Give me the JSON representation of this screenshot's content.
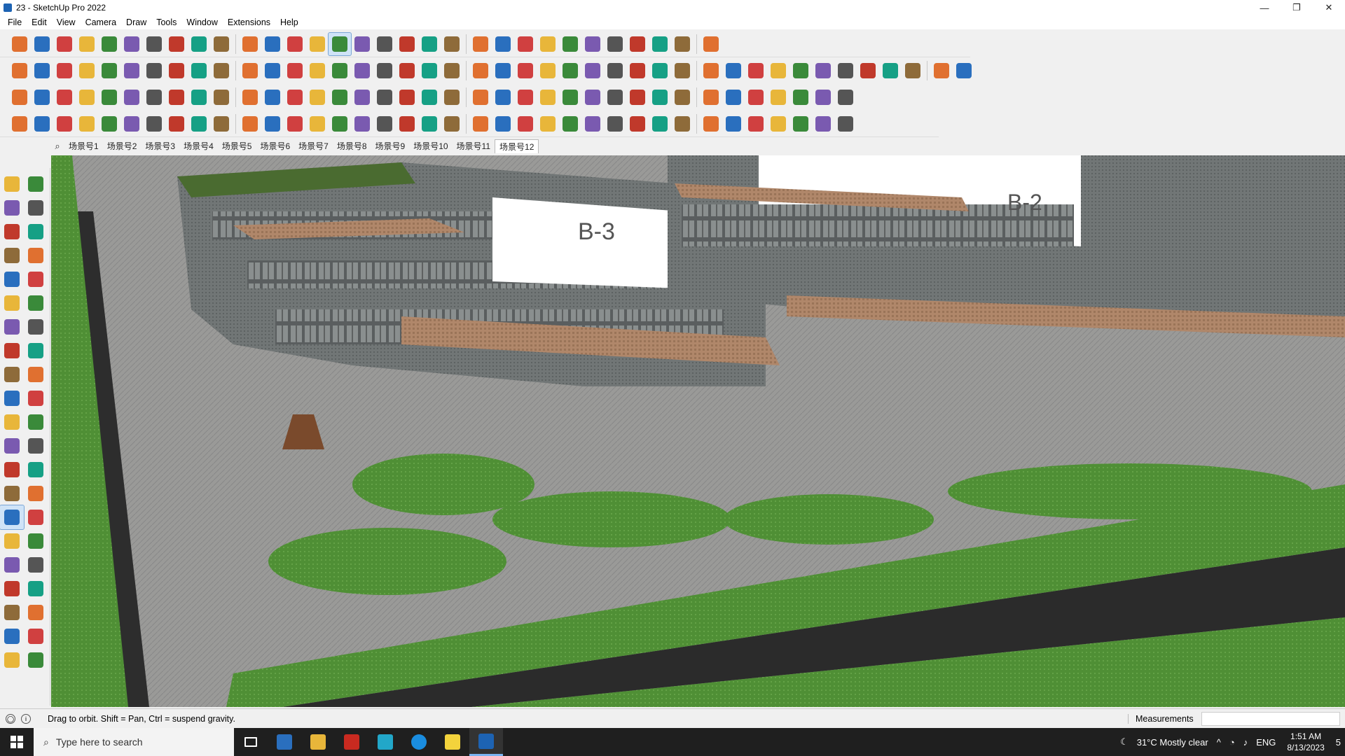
{
  "window": {
    "title": "23 - SketchUp Pro 2022",
    "controls": [
      "—",
      "❐",
      "✕"
    ]
  },
  "menu": [
    "File",
    "Edit",
    "View",
    "Camera",
    "Draw",
    "Tools",
    "Window",
    "Extensions",
    "Help"
  ],
  "toolbars": {
    "row1": [
      "zoom-extents",
      "select",
      "eraser",
      "pencil-line",
      "arc",
      "rectangle",
      "push-pull",
      "follow-me",
      "move",
      "rotate",
      "scale",
      "tape-measure",
      "text",
      "paint-bucket",
      "orbit",
      "pan",
      "zoom",
      "zoom-window",
      "sandbox",
      "layers-1",
      "layers-2",
      "layers-3",
      "section",
      "walk",
      "camera-tool",
      "look",
      "position",
      "flip",
      "undo",
      "redo",
      "model-info"
    ],
    "row2": [
      "solid-1",
      "solid-2",
      "solid-3",
      "push-red",
      "move-up",
      "move-down",
      "shear",
      "axis",
      "twist",
      "warp",
      "curve",
      "section-a",
      "section-b",
      "section-c",
      "ladder-1",
      "ladder-2",
      "house-1",
      "house-2",
      "house-3",
      "house-4",
      "house-5",
      "tag",
      "stone",
      "shape-1",
      "shape-2",
      "shape-3",
      "shape-4",
      "shape-5",
      "shape-6",
      "shape-7",
      "shape-8",
      "shape-9",
      "shape-10",
      "shape-11",
      "tool-a",
      "tool-b",
      "tool-c",
      "tool-d",
      "tool-e",
      "tool-f",
      "tool-g",
      "tool-h"
    ],
    "row3": [
      "plane-1",
      "plane-2",
      "plane-3",
      "plane-4",
      "plane-5",
      "curve-a",
      "box-a",
      "frame-a",
      "door-a",
      "glass-a",
      "curve-b",
      "path-a",
      "pipe-a",
      "cross-a",
      "x-a",
      "cone-a",
      "tent-a",
      "warn-a",
      "loop-a",
      "loop-b",
      "loop-c",
      "flower-a",
      "cup-a",
      "hook-a",
      "tree-a",
      "grid-a",
      "grid-b",
      "grid-c",
      "grid-d",
      "grid-e",
      "grid-f",
      "tile-a",
      "tile-b",
      "tile-c",
      "x-b",
      "arc-a",
      "dots-a"
    ],
    "row4": [
      "poly-1",
      "poly-2",
      "poly-3",
      "poly-4",
      "poly-5",
      "poly-6",
      "poly-7",
      "poly-8",
      "poly-9",
      "poly-10",
      "poly-11",
      "poly-12",
      "poly-13",
      "poly-14",
      "poly-15",
      "poly-16",
      "poly-17",
      "poly-18",
      "poly-19",
      "poly-20",
      "poly-21",
      "poly-22",
      "poly-23",
      "poly-24",
      "poly-25",
      "poly-26",
      "poly-27",
      "poly-28",
      "poly-29",
      "poly-30",
      "poly-31",
      "poly-32",
      "poly-33",
      "poly-34",
      "poly-35",
      "poly-36",
      "poly-37"
    ]
  },
  "scenes": {
    "tabs": [
      "场景号1",
      "场景号2",
      "场景号3",
      "场景号4",
      "场景号5",
      "场景号6",
      "场景号7",
      "场景号8",
      "场景号9",
      "场景号10",
      "场景号11",
      "场景号12"
    ],
    "active": "场景号12"
  },
  "viewport": {
    "labels": {
      "b3": "B-3",
      "b2": "B-2"
    }
  },
  "status": {
    "hint": "Drag to orbit. Shift = Pan, Ctrl = suspend gravity.",
    "measurements_label": "Measurements",
    "measurements_value": ""
  },
  "taskbar": {
    "search_placeholder": "Type here to search",
    "weather": "31°C  Mostly clear",
    "lang": "ENG",
    "time": "1:51 AM",
    "date": "8/13/2023",
    "notifications": "5"
  },
  "colors": {
    "accent": "#1d63b3",
    "grass": "#4e8f33",
    "road": "#2d2d2d",
    "wall": "#6f7474",
    "timber": "#c9a46c"
  }
}
